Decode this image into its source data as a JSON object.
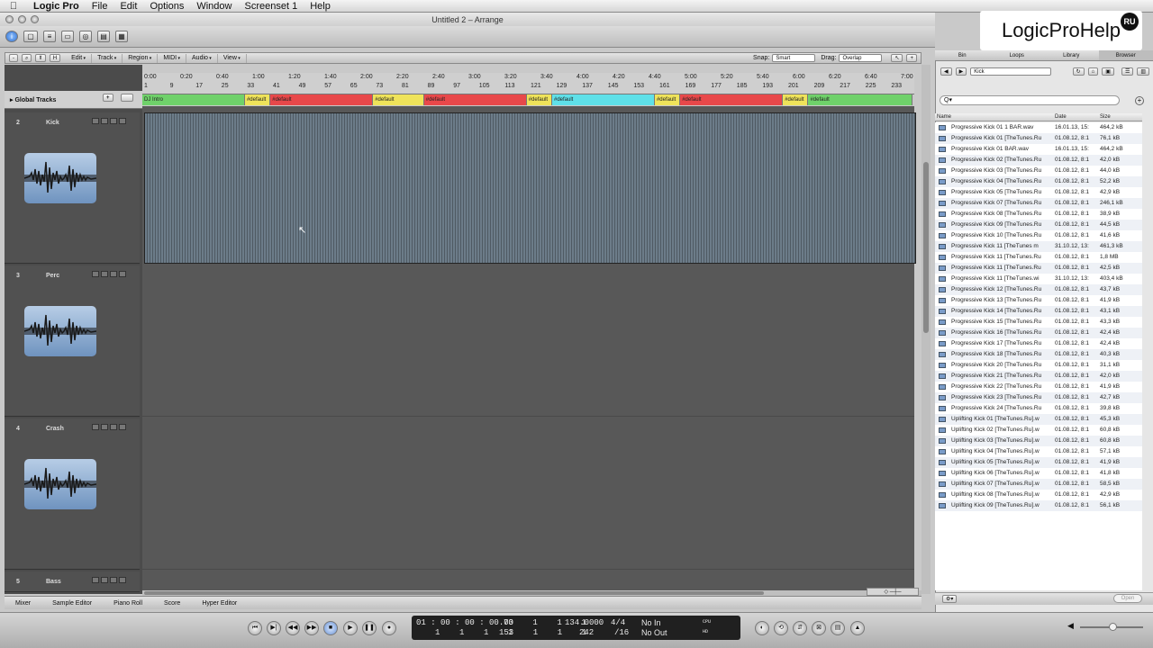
{
  "menubar": {
    "apple": "",
    "app": "Logic Pro",
    "items": [
      "File",
      "Edit",
      "Options",
      "Window",
      "Screenset 1",
      "Help"
    ]
  },
  "window": {
    "title": "Untitled 2 – Arrange"
  },
  "brand": {
    "text": "LogicProHelp",
    "badge": "RU"
  },
  "arrange_menu": {
    "items": [
      "Edit",
      "Track",
      "Region",
      "MIDI",
      "Audio",
      "View"
    ],
    "snap_label": "Snap:",
    "snap_value": "Smart",
    "drag_label": "Drag:",
    "drag_value": "Overlap",
    "icon_buttons": [
      "-",
      "⌕",
      "⫪",
      "H"
    ]
  },
  "ruler": {
    "times": [
      "0:00",
      "0:20",
      "0:40",
      "1:00",
      "1:20",
      "1:40",
      "2:00",
      "2:20",
      "2:40",
      "3:00",
      "3:20",
      "3:40",
      "4:00",
      "4:20",
      "4:40",
      "5:00",
      "5:20",
      "5:40",
      "6:00",
      "6:20",
      "6:40",
      "7:00"
    ],
    "bars": [
      "1",
      "9",
      "17",
      "25",
      "33",
      "41",
      "49",
      "57",
      "65",
      "73",
      "81",
      "89",
      "97",
      "105",
      "113",
      "121",
      "129",
      "137",
      "145",
      "153",
      "161",
      "169",
      "177",
      "185",
      "193",
      "201",
      "209",
      "217",
      "225",
      "233"
    ]
  },
  "global_tracks": {
    "label": "Global Tracks",
    "buttons": [
      "+",
      ""
    ]
  },
  "markers": [
    {
      "label": "DJ Intro",
      "color": "#6fd16a",
      "span": 0.133
    },
    {
      "label": "#default",
      "color": "#efe35a",
      "span": 0.033
    },
    {
      "label": "#default",
      "color": "#e8484a",
      "span": 0.133
    },
    {
      "label": "#default",
      "color": "#efe35a",
      "span": 0.066
    },
    {
      "label": "#default",
      "color": "#e8484a",
      "span": 0.133
    },
    {
      "label": "#default",
      "color": "#efe35a",
      "span": 0.033
    },
    {
      "label": "#default",
      "color": "#5fe0e8",
      "span": 0.133
    },
    {
      "label": "#default",
      "color": "#efe35a",
      "span": 0.033
    },
    {
      "label": "#default",
      "color": "#e8484a",
      "span": 0.133
    },
    {
      "label": "#default",
      "color": "#efe35a",
      "span": 0.033
    },
    {
      "label": "#default",
      "color": "#6fd16a",
      "span": 0.135
    }
  ],
  "tracks": [
    {
      "num": "2",
      "name": "Kick"
    },
    {
      "num": "3",
      "name": "Perc"
    },
    {
      "num": "4",
      "name": "Crash"
    },
    {
      "num": "5",
      "name": "Bass"
    }
  ],
  "bottom_tabs": [
    "Mixer",
    "Sample Editor",
    "Piano Roll",
    "Score",
    "Hyper Editor"
  ],
  "transport": {
    "buttons": [
      "⏮",
      "▶|",
      "◀◀",
      "▶▶",
      "■",
      "▶",
      "❚❚",
      "●"
    ],
    "smpte": "01 : 00 : 00 : 00.00",
    "smpte_bar": "73    1    1    1",
    "pos_bar": "1    1    1    1",
    "pos_bar2": "153    1    1    1",
    "tempo": "134.0000",
    "timesig": "4/4",
    "division_val": "242",
    "division": "/16",
    "in": "No In",
    "out": "No Out",
    "cpu": "CPU",
    "hd": "HD",
    "right_buttons": [
      "◐",
      "⟲",
      "⇵",
      "⊠",
      "▤",
      "▲"
    ]
  },
  "browser": {
    "tabs": [
      "Bin",
      "Loops",
      "Library",
      "Browser"
    ],
    "selected_tab": "Browser",
    "path": "Kick",
    "search_placeholder": "Q▾",
    "columns": [
      "Name",
      "Date",
      "Size"
    ],
    "files": [
      [
        "Progressive Kick 01 1 BAR.wav",
        "16.01.13, 15:",
        "464,2 kB"
      ],
      [
        "Progressive Kick 01 [TheTunes.Ru",
        "01.08.12, 8:1",
        "76,1 kB"
      ],
      [
        "Progressive Kick 01 BAR.wav",
        "16.01.13, 15:",
        "464,2 kB"
      ],
      [
        "Progressive Kick 02 [TheTunes.Ru",
        "01.08.12, 8:1",
        "42,0 kB"
      ],
      [
        "Progressive Kick 03 [TheTunes.Ru",
        "01.08.12, 8:1",
        "44,0 kB"
      ],
      [
        "Progressive Kick 04 [TheTunes.Ru",
        "01.08.12, 8:1",
        "52,2 kB"
      ],
      [
        "Progressive Kick 05 [TheTunes.Ru",
        "01.08.12, 8:1",
        "42,9 kB"
      ],
      [
        "Progressive Kick 07 [TheTunes.Ru",
        "01.08.12, 8:1",
        "246,1 kB"
      ],
      [
        "Progressive Kick 08 [TheTunes.Ru",
        "01.08.12, 8:1",
        "38,9 kB"
      ],
      [
        "Progressive Kick 09 [TheTunes.Ru",
        "01.08.12, 8:1",
        "44,5 kB"
      ],
      [
        "Progressive Kick 10 [TheTunes.Ru",
        "01.08.12, 8:1",
        "41,6 kB"
      ],
      [
        "Progressive Kick 11 [TheTunes m",
        "31.10.12, 13:",
        "461,3 kB"
      ],
      [
        "Progressive Kick 11 [TheTunes.Ru",
        "01.08.12, 8:1",
        "1,8 MB"
      ],
      [
        "Progressive Kick 11 [TheTunes.Ru",
        "01.08.12, 8:1",
        "42,5 kB"
      ],
      [
        "Progressive Kick 11 [TheTunes.wi",
        "31.10.12, 13:",
        "403,4 kB"
      ],
      [
        "Progressive Kick 12 [TheTunes.Ru",
        "01.08.12, 8:1",
        "43,7 kB"
      ],
      [
        "Progressive Kick 13 [TheTunes.Ru",
        "01.08.12, 8:1",
        "41,9 kB"
      ],
      [
        "Progressive Kick 14 [TheTunes.Ru",
        "01.08.12, 8:1",
        "43,1 kB"
      ],
      [
        "Progressive Kick 15 [TheTunes.Ru",
        "01.08.12, 8:1",
        "43,3 kB"
      ],
      [
        "Progressive Kick 16 [TheTunes.Ru",
        "01.08.12, 8:1",
        "42,4 kB"
      ],
      [
        "Progressive Kick 17 [TheTunes.Ru",
        "01.08.12, 8:1",
        "42,4 kB"
      ],
      [
        "Progressive Kick 18 [TheTunes.Ru",
        "01.08.12, 8:1",
        "40,3 kB"
      ],
      [
        "Progressive Kick 20 [TheTunes.Ru",
        "01.08.12, 8:1",
        "31,1 kB"
      ],
      [
        "Progressive Kick 21 [TheTunes.Ru",
        "01.08.12, 8:1",
        "42,0 kB"
      ],
      [
        "Progressive Kick 22 [TheTunes.Ru",
        "01.08.12, 8:1",
        "41,9 kB"
      ],
      [
        "Progressive Kick 23 [TheTunes.Ru",
        "01.08.12, 8:1",
        "42,7 kB"
      ],
      [
        "Progressive Kick 24 [TheTunes.Ru",
        "01.08.12, 8:1",
        "39,8 kB"
      ],
      [
        "Uplifting Kick 01 [TheTunes.Ru].w",
        "01.08.12, 8:1",
        "45,3 kB"
      ],
      [
        "Uplifting Kick 02 [TheTunes.Ru].w",
        "01.08.12, 8:1",
        "60,8 kB"
      ],
      [
        "Uplifting Kick 03 [TheTunes.Ru].w",
        "01.08.12, 8:1",
        "60,8 kB"
      ],
      [
        "Uplifting Kick 04 [TheTunes.Ru].w",
        "01.08.12, 8:1",
        "57,1 kB"
      ],
      [
        "Uplifting Kick 05 [TheTunes.Ru].w",
        "01.08.12, 8:1",
        "41,9 kB"
      ],
      [
        "Uplifting Kick 06 [TheTunes.Ru].w",
        "01.08.12, 8:1",
        "41,8 kB"
      ],
      [
        "Uplifting Kick 07 [TheTunes.Ru].w",
        "01.08.12, 8:1",
        "58,5 kB"
      ],
      [
        "Uplifting Kick 08 [TheTunes.Ru].w",
        "01.08.12, 8:1",
        "42,9 kB"
      ],
      [
        "Uplifting Kick 09 [TheTunes.Ru].w",
        "01.08.12, 8:1",
        "56,1 kB"
      ]
    ],
    "footer_gear": "⚙▾",
    "open_label": "Open"
  }
}
